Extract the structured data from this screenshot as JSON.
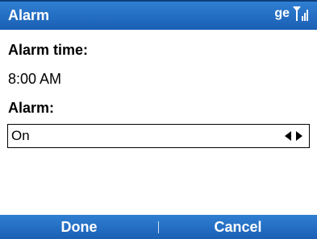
{
  "title_bar": {
    "title": "Alarm",
    "status_text": "ge",
    "signal_icon": "signal-strength-icon"
  },
  "form": {
    "alarm_time_label": "Alarm time:",
    "alarm_time_value": "8:00 AM",
    "alarm_label": "Alarm:",
    "alarm_value": "On"
  },
  "softkeys": {
    "left": "Done",
    "right": "Cancel"
  },
  "colors": {
    "bar_blue": "#1a5fb4"
  }
}
